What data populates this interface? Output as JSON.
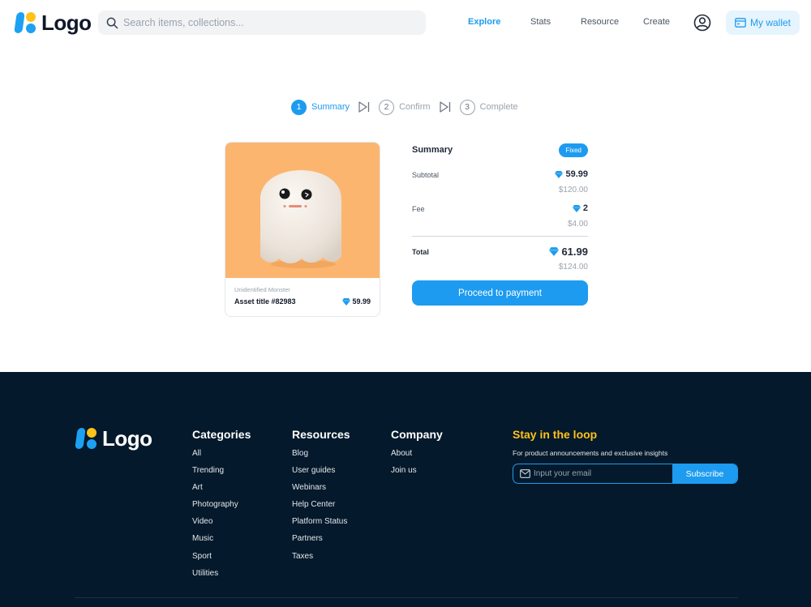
{
  "header": {
    "logo_text": "Logo",
    "search_placeholder": "Search items, collections...",
    "nav": [
      "Explore",
      "Stats",
      "Resource",
      "Create"
    ],
    "wallet_label": "My wallet"
  },
  "stepper": {
    "steps": [
      {
        "number": "1",
        "label": "Summary"
      },
      {
        "number": "2",
        "label": "Confirm"
      },
      {
        "number": "3",
        "label": "Complete"
      }
    ],
    "active_step": 1
  },
  "asset": {
    "collection": "Unidentified Monster",
    "title": "Asset title #82983",
    "price": "59.99"
  },
  "summary": {
    "title": "Summary",
    "badge": "Fixed",
    "subtotal_label": "Subtotal",
    "subtotal_value": "59.99",
    "subtotal_usd": "$120.00",
    "fee_label": "Fee",
    "fee_value": "2",
    "fee_usd": "$4.00",
    "total_label": "Total",
    "total_value": "61.99",
    "total_usd": "$124.00",
    "cta": "Proceed to payment"
  },
  "footer": {
    "logo_text": "Logo",
    "categories": {
      "title": "Categories",
      "items": [
        "All",
        "Trending",
        "Art",
        "Photography",
        "Video",
        "Music",
        "Sport",
        "Utilities"
      ]
    },
    "resources": {
      "title": "Resources",
      "items": [
        "Blog",
        "User guides",
        "Webinars",
        "Help Center",
        "Platform Status",
        "Partners",
        "Taxes"
      ]
    },
    "company": {
      "title": "Company",
      "items": [
        "About",
        "Join us"
      ]
    },
    "newsletter": {
      "title": "Stay in the loop",
      "subtitle": "For product announcements and exclusive insights",
      "placeholder": "Input your email",
      "button": "Subscribe"
    }
  },
  "colors": {
    "accent": "#1d9bf0",
    "logo_yellow": "#ffc21a",
    "footer_bg": "#04192b",
    "card_bg": "#fcb56e"
  },
  "icons": {
    "search": "search-icon",
    "user": "user-circle-icon",
    "wallet": "wallet-icon",
    "currency": "diamond-icon",
    "step_separator": "skip-forward-icon",
    "email": "envelope-icon"
  }
}
